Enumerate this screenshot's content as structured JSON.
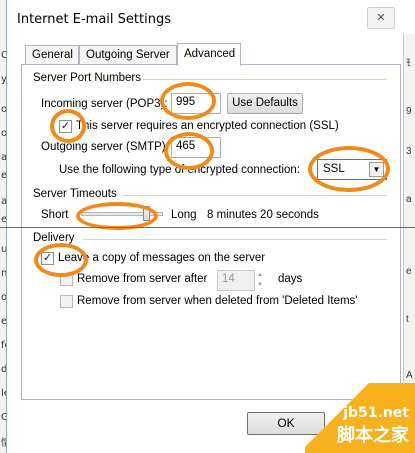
{
  "background_window": {
    "left_fragments": [
      "C",
      "y",
      "or",
      "on",
      "a",
      "e",
      "a",
      "e",
      "u",
      "ng",
      "o",
      "e",
      "fe",
      "d",
      "le",
      "G",
      "情"
    ],
    "right_fragments": [
      "ﾓ",
      "9",
      "3",
      "a",
      "e",
      "t",
      "A"
    ]
  },
  "dialog": {
    "title": "Internet E-mail Settings",
    "close_icon": "close-icon",
    "tabs": [
      {
        "label": "General",
        "active": false
      },
      {
        "label": "Outgoing Server",
        "active": false
      },
      {
        "label": "Advanced",
        "active": true
      }
    ],
    "server_ports": {
      "group_title": "Server Port Numbers",
      "incoming_label": "Incoming server (POP3):",
      "incoming_value": "995",
      "use_defaults_label": "Use Defaults",
      "incoming_ssl_label": "This server requires an encrypted connection (SSL)",
      "incoming_ssl_checked": true,
      "outgoing_label": "Outgoing server (SMTP):",
      "outgoing_value": "465",
      "encryption_label": "Use the following type of encrypted connection:",
      "encryption_value": "SSL"
    },
    "timeouts": {
      "group_title": "Server Timeouts",
      "short_label": "Short",
      "long_label": "Long",
      "value_text": "8 minutes 20 seconds"
    },
    "delivery": {
      "group_title": "Delivery",
      "leave_copy_label": "Leave a copy of messages on the server",
      "leave_copy_checked": true,
      "remove_after_label": "Remove from server after",
      "remove_after_value": "14",
      "days_label": "days",
      "remove_deleted_label": "Remove from server when deleted from 'Deleted Items'"
    },
    "ok_label": "OK"
  },
  "watermark": {
    "site": "jb51.net",
    "name": "脚本之家"
  },
  "colors": {
    "annotation_ring": "#f08a1a",
    "annotation_line": "#e03a3a",
    "watermark": "#f7b11a"
  }
}
